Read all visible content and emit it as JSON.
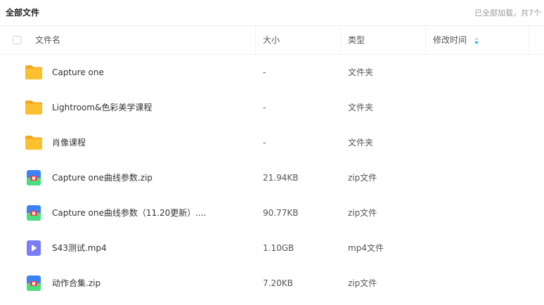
{
  "header": {
    "title": "全部文件",
    "count_text": "已全部加载，共7个"
  },
  "columns": {
    "name": "文件名",
    "size": "大小",
    "type": "类型",
    "modified": "修改时间"
  },
  "icons": {
    "sort": "sort-icon",
    "folder": "folder-icon",
    "zip": "zip-icon",
    "video": "video-icon"
  },
  "colors": {
    "folder": "#FBBF24",
    "zip_blue": "#3B82F6",
    "zip_green": "#4ADE80",
    "zip_red": "#EF4444",
    "video": "#7C7CF6",
    "sort": "#2EA8FF"
  },
  "files": [
    {
      "name": "Capture one",
      "size": "-",
      "type": "文件夹",
      "icon": "folder"
    },
    {
      "name": "Lightroom&色彩美学课程",
      "size": "-",
      "type": "文件夹",
      "icon": "folder"
    },
    {
      "name": "肖像课程",
      "size": "-",
      "type": "文件夹",
      "icon": "folder"
    },
    {
      "name": "Capture one曲线参数.zip",
      "size": "21.94KB",
      "type": "zip文件",
      "icon": "zip"
    },
    {
      "name": "Capture one曲线参数（11.20更新）....",
      "size": "90.77KB",
      "type": "zip文件",
      "icon": "zip"
    },
    {
      "name": "S43测试.mp4",
      "size": "1.10GB",
      "type": "mp4文件",
      "icon": "video"
    },
    {
      "name": "动作合集.zip",
      "size": "7.20KB",
      "type": "zip文件",
      "icon": "zip"
    }
  ]
}
